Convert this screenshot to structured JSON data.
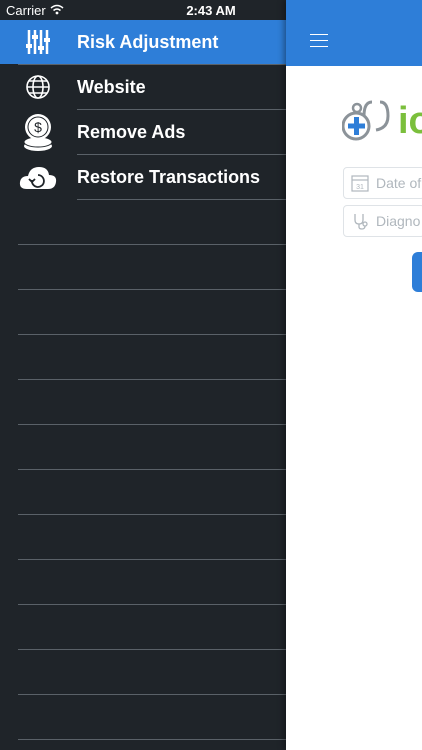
{
  "status_bar": {
    "carrier": "Carrier",
    "time": "2:43 AM"
  },
  "menu": {
    "items": [
      {
        "label": "Risk Adjustment",
        "icon": "sliders-icon",
        "active": true
      },
      {
        "label": "Website",
        "icon": "globe-icon",
        "active": false
      },
      {
        "label": "Remove Ads",
        "icon": "coins-icon",
        "active": false
      },
      {
        "label": "Restore Transactions",
        "icon": "cloud-restore-icon",
        "active": false
      }
    ]
  },
  "content": {
    "logo_text": "io",
    "date_placeholder": "Date of",
    "diagnosis_placeholder": "Diagno"
  },
  "colors": {
    "accent": "#2e7ed8",
    "menu_bg": "#1f2429",
    "logo_green": "#7bbf3c"
  }
}
